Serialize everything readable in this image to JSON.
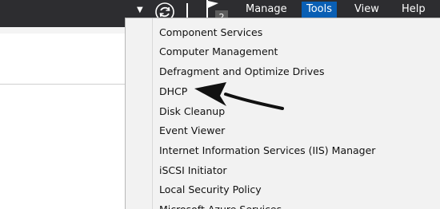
{
  "toolbar": {
    "menus": [
      {
        "label": "Manage"
      },
      {
        "label": "Tools"
      },
      {
        "label": "View"
      },
      {
        "label": "Help"
      }
    ],
    "notification_count": "2"
  },
  "tools_menu": {
    "items": [
      {
        "label": "Component Services"
      },
      {
        "label": "Computer Management"
      },
      {
        "label": "Defragment and Optimize Drives"
      },
      {
        "label": "DHCP"
      },
      {
        "label": "Disk Cleanup"
      },
      {
        "label": "Event Viewer"
      },
      {
        "label": "Internet Information Services (IIS) Manager"
      },
      {
        "label": "iSCSI Initiator"
      },
      {
        "label": "Local Security Policy"
      },
      {
        "label": "Microsoft Azure Services"
      }
    ]
  },
  "icons": {
    "refresh": "refresh-icon",
    "flag": "notification-flag-icon",
    "dropdown": "dropdown-arrow-icon",
    "pointer": "annotation-arrow-icon"
  },
  "colors": {
    "toolbar_bg": "#2d2d30",
    "active_menu": "#0a5fb4",
    "menu_bg": "#f2f2f2"
  }
}
